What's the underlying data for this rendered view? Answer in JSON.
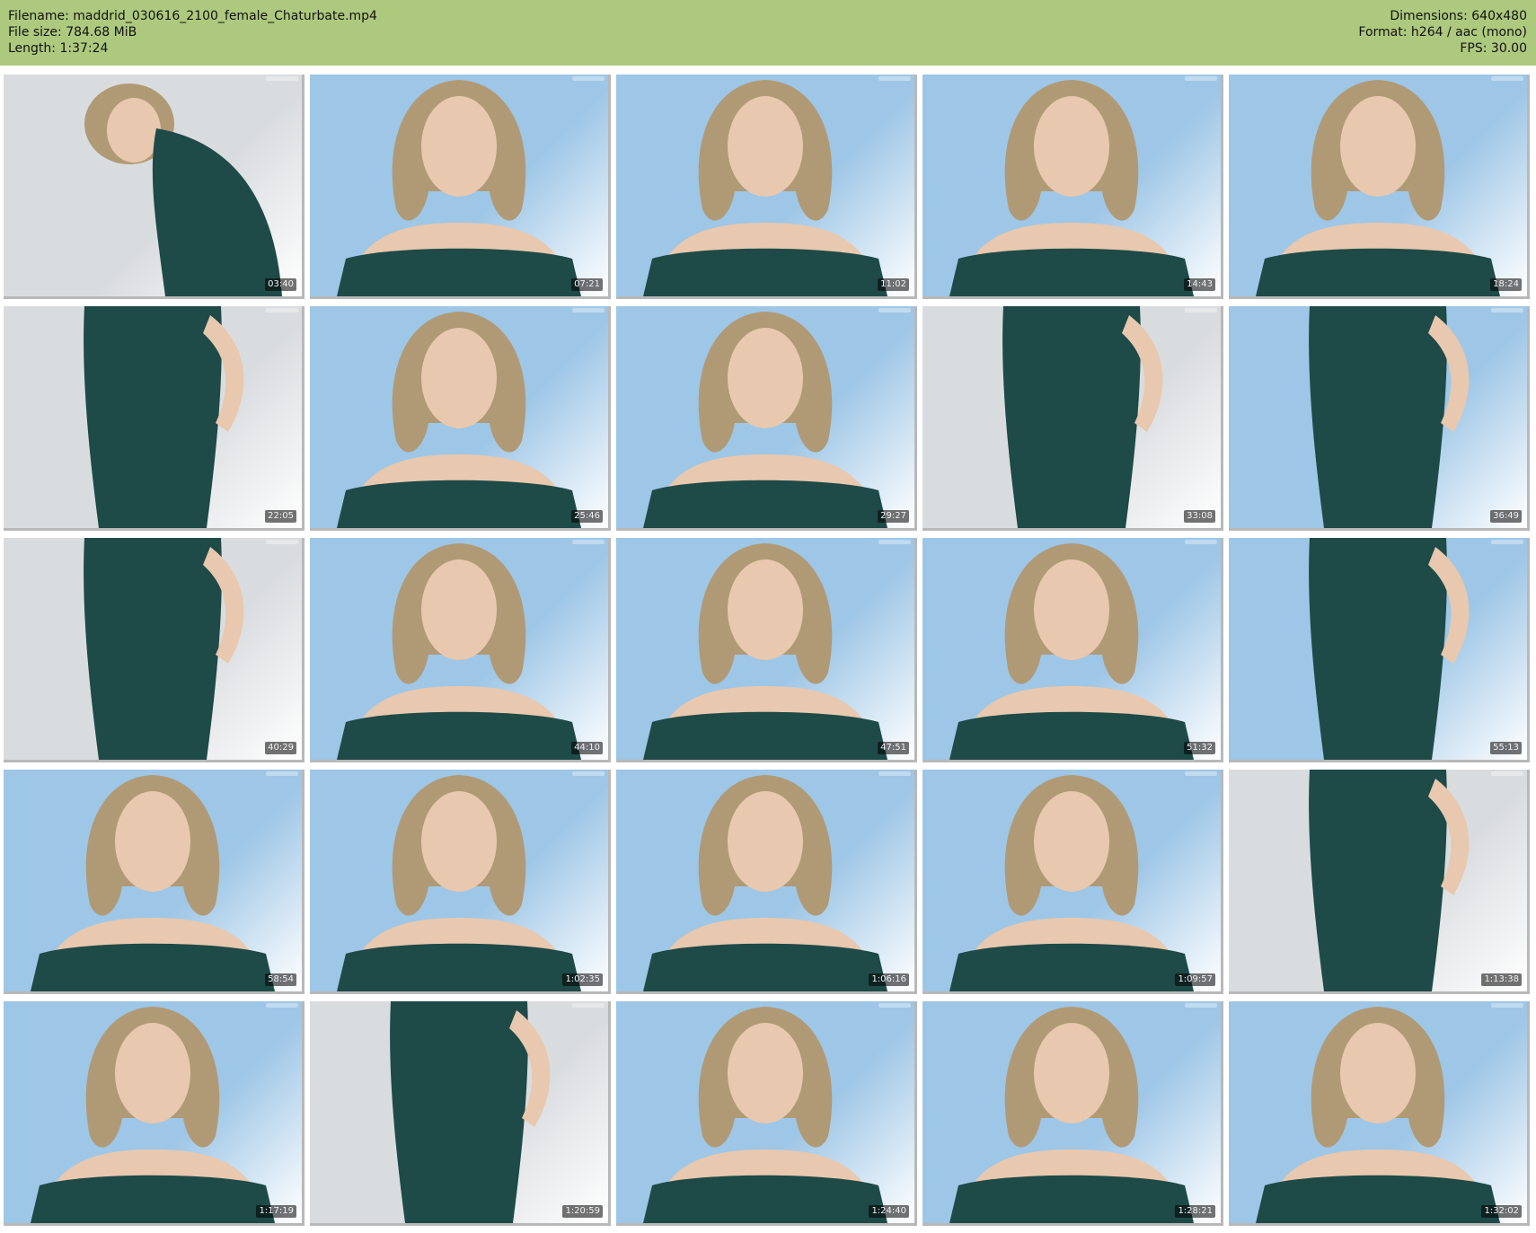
{
  "header": {
    "filename": "Filename: maddrid_030616_2100_female_Chaturbate.mp4",
    "filesize": "File size: 784.68 MiB",
    "length": "Length: 1:37:24",
    "dimensions": "Dimensions: 640x480",
    "format": "Format: h264 / aac (mono)",
    "fps": "FPS: 30.00"
  },
  "colors": {
    "header_bg": "#adc97e",
    "wall_blue": "#9ec6e6",
    "wall_grey": "#d9dcdf",
    "dress": "#1e4a48",
    "hair": "#b09a76",
    "skin": "#e8c8ae"
  },
  "thumbnails": [
    {
      "time": "03:40",
      "scene": "side",
      "bg": "grey"
    },
    {
      "time": "07:21",
      "scene": "portrait",
      "bg": "blue"
    },
    {
      "time": "11:02",
      "scene": "portrait",
      "bg": "blue"
    },
    {
      "time": "14:43",
      "scene": "portrait",
      "bg": "blue"
    },
    {
      "time": "18:24",
      "scene": "portrait",
      "bg": "blue"
    },
    {
      "time": "22:05",
      "scene": "dress",
      "bg": "grey"
    },
    {
      "time": "25:46",
      "scene": "portrait",
      "bg": "blue"
    },
    {
      "time": "29:27",
      "scene": "portrait",
      "bg": "blue"
    },
    {
      "time": "33:08",
      "scene": "dress",
      "bg": "grey"
    },
    {
      "time": "36:49",
      "scene": "dress",
      "bg": "blue"
    },
    {
      "time": "40:29",
      "scene": "dress",
      "bg": "grey"
    },
    {
      "time": "44:10",
      "scene": "portrait",
      "bg": "blue"
    },
    {
      "time": "47:51",
      "scene": "portrait",
      "bg": "blue"
    },
    {
      "time": "51:32",
      "scene": "portrait",
      "bg": "blue"
    },
    {
      "time": "55:13",
      "scene": "dress",
      "bg": "blue"
    },
    {
      "time": "58:54",
      "scene": "portrait",
      "bg": "blue"
    },
    {
      "time": "1:02:35",
      "scene": "portrait",
      "bg": "blue"
    },
    {
      "time": "1:06:16",
      "scene": "portrait",
      "bg": "blue"
    },
    {
      "time": "1:09:57",
      "scene": "portrait",
      "bg": "blue"
    },
    {
      "time": "1:13:38",
      "scene": "dress",
      "bg": "grey"
    },
    {
      "time": "1:17:19",
      "scene": "portrait",
      "bg": "blue"
    },
    {
      "time": "1:20:59",
      "scene": "dress",
      "bg": "grey"
    },
    {
      "time": "1:24:40",
      "scene": "portrait",
      "bg": "blue"
    },
    {
      "time": "1:28:21",
      "scene": "portrait",
      "bg": "blue"
    },
    {
      "time": "1:32:02",
      "scene": "portrait",
      "bg": "blue"
    }
  ]
}
